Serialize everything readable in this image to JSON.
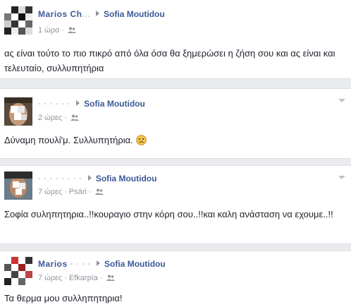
{
  "posts": [
    {
      "author_visible": "Marios Ch",
      "author_blurred": "...",
      "target": "Sofia Moutidou",
      "time": "1 ώρα",
      "location": "",
      "audience_icon": "friends-icon",
      "text": "ας είναι τούτο το πιο πικρό από όλα όσα θα ξημερώσει η ζήση σου και ας είναι και τελευταίο, συλλυπητήρια"
    },
    {
      "author_visible": "",
      "author_blurred": "· · ·  · · ·",
      "target": "Sofia Moutidou",
      "time": "2 ώρες",
      "location": "",
      "audience_icon": "friends-icon",
      "text": "Δύναμη πουλί'μ. Συλλυπητήρια.",
      "emoticon": "frown-smiley-icon"
    },
    {
      "author_visible": "",
      "author_blurred": "· · · · · · · ·",
      "target": "Sofia Moutidou",
      "time": "7 ώρες",
      "location": "Psári",
      "audience_icon": "friends-icon",
      "text": "Σοφία συληπητηρια..!!κουραγιο στην κόρη σου..!!και καλη ανάσταση να εχουμε..!!"
    },
    {
      "author_visible": "Marios",
      "author_blurred": "· · · ·",
      "target": "Sofia Moutidou",
      "time": "7 ώρες",
      "location": "Efkarpía",
      "audience_icon": "friends-icon",
      "text": "Τα θερμα μου συλληπητηρια!"
    }
  ],
  "colors": {
    "link": "#3b5998",
    "meta": "#90949c",
    "text": "#1d2129",
    "background": "#e9ebee"
  }
}
